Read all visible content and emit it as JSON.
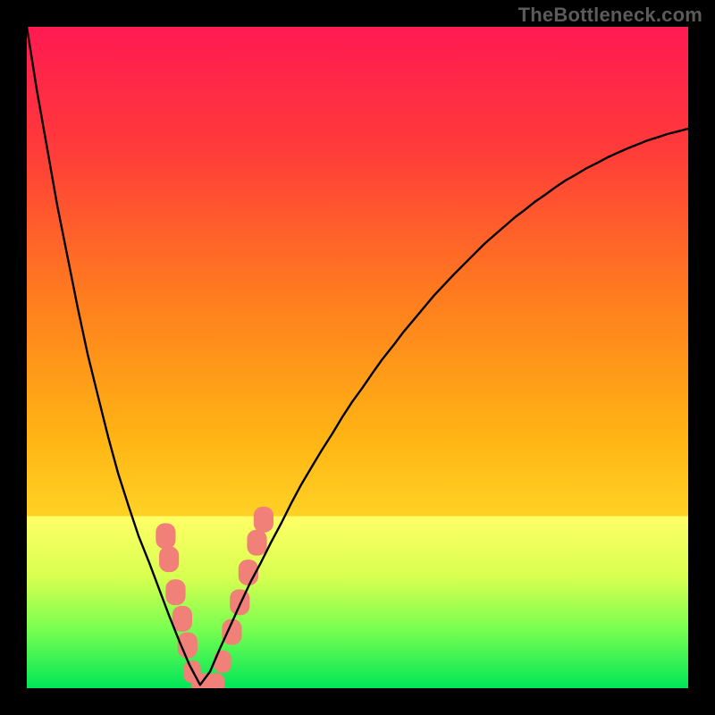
{
  "watermark": "TheBottleneck.com",
  "chart_data": {
    "type": "line",
    "title": "",
    "xlabel": "",
    "ylabel": "",
    "xlim": [
      0,
      100
    ],
    "ylim": [
      0,
      100
    ],
    "grid": false,
    "legend": false,
    "curve": {
      "comment": "V-shaped black curve. Two branches meeting at a rounded minimum near x≈26, y≈0. Left branch is steep (x from 0→26, y from 100→0). Right branch rises with diminishing slope toward the upper-right (y reaching ≈80 at x=100). Values below are (x, y) pairs estimated from the plot.",
      "x": [
        0.0,
        1.5,
        3.1,
        4.6,
        6.2,
        7.7,
        9.2,
        10.8,
        12.3,
        13.8,
        15.4,
        16.9,
        18.5,
        20.0,
        21.5,
        23.1,
        24.6,
        26.2,
        27.7,
        29.2,
        30.8,
        32.3,
        33.8,
        35.4,
        36.9,
        38.5,
        40.0,
        41.5,
        43.1,
        44.6,
        46.2,
        47.7,
        49.2,
        50.8,
        52.3,
        53.8,
        55.4,
        56.9,
        58.5,
        60.0,
        61.5,
        63.1,
        64.6,
        66.2,
        67.7,
        69.2,
        70.8,
        72.3,
        73.8,
        75.4,
        76.9,
        78.5,
        80.0,
        81.5,
        83.1,
        84.6,
        86.2,
        87.7,
        89.2,
        90.8,
        92.3,
        93.8,
        95.4,
        96.9,
        98.5,
        100.0
      ],
      "y": [
        100.0,
        90.5,
        81.5,
        73.0,
        65.0,
        57.5,
        50.5,
        44.0,
        38.0,
        32.5,
        27.5,
        23.0,
        19.0,
        15.0,
        11.0,
        7.0,
        3.5,
        0.5,
        2.5,
        6.0,
        9.5,
        12.8,
        16.0,
        19.0,
        22.0,
        25.0,
        28.0,
        30.8,
        33.5,
        36.0,
        38.5,
        41.0,
        43.3,
        45.5,
        47.7,
        49.8,
        51.8,
        53.8,
        55.7,
        57.5,
        59.3,
        61.0,
        62.6,
        64.2,
        65.7,
        67.2,
        68.6,
        69.9,
        71.2,
        72.4,
        73.6,
        74.7,
        75.8,
        76.8,
        77.7,
        78.6,
        79.4,
        80.2,
        80.9,
        81.6,
        82.2,
        82.8,
        83.3,
        83.8,
        84.2,
        84.6
      ]
    },
    "markers": {
      "comment": "Salmon/pink rounded-rectangle markers concentrated near the valley on both branches. (x, y, size) triples; size ≈ marker side in plot units.",
      "color": "#f08078",
      "points": [
        [
          21.0,
          23.0,
          3.0
        ],
        [
          21.5,
          19.5,
          3.0
        ],
        [
          22.5,
          14.5,
          3.0
        ],
        [
          23.5,
          10.5,
          3.0
        ],
        [
          24.3,
          6.5,
          3.0
        ],
        [
          25.0,
          2.5,
          2.6
        ],
        [
          26.2,
          0.6,
          2.6
        ],
        [
          27.4,
          0.6,
          2.6
        ],
        [
          28.6,
          0.6,
          2.6
        ],
        [
          29.6,
          4.0,
          2.6
        ],
        [
          31.0,
          8.5,
          3.0
        ],
        [
          32.2,
          13.0,
          3.0
        ],
        [
          33.5,
          17.5,
          3.0
        ],
        [
          34.8,
          22.0,
          3.0
        ],
        [
          35.8,
          25.5,
          3.0
        ]
      ]
    },
    "band": {
      "comment": "Horizontal yellow-to-green band spanning full width at the bottom of the plot, y from 0 to ≈26.",
      "y_top": 26.0,
      "y_bottom": 0.0,
      "top_color": "#ffff66",
      "bottom_color": "#00e658"
    },
    "background_gradient": {
      "comment": "Main plot background vertical gradient, red-magenta at top through orange to yellow near the band.",
      "stops": [
        {
          "offset": 0.0,
          "color": "#ff1a52"
        },
        {
          "offset": 0.18,
          "color": "#ff3a3a"
        },
        {
          "offset": 0.4,
          "color": "#ff7a1f"
        },
        {
          "offset": 0.62,
          "color": "#ffb414"
        },
        {
          "offset": 0.8,
          "color": "#ffe02e"
        },
        {
          "offset": 1.0,
          "color": "#ffff5a"
        }
      ]
    }
  }
}
